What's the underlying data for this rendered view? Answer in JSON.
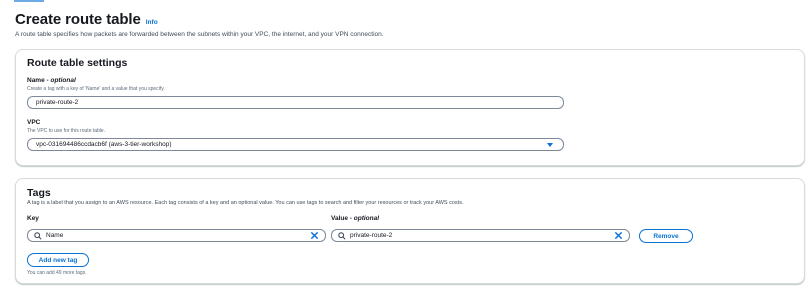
{
  "page": {
    "title": "Create route table",
    "info_label": "Info",
    "description": "A route table specifies how packets are forwarded between the subnets within your VPC, the internet, and your VPN connection."
  },
  "route_table_settings": {
    "title": "Route table settings",
    "name_label": "Name",
    "name_optional": " - optional",
    "name_desc": "Create a tag with a key of 'Name' and a value that you specify.",
    "name_value": "private-route-2",
    "vpc_label": "VPC",
    "vpc_desc": "The VPC to use for this route table.",
    "vpc_value": "vpc-031694486ccdacb6f (aws-3-tier-workshop)"
  },
  "tags": {
    "title": "Tags",
    "description": "A tag is a label that you assign to an AWS resource. Each tag consists of a key and an optional value. You can use tags to search and filter your resources or track your AWS costs.",
    "key_label": "Key",
    "value_label": "Value",
    "value_optional": " - optional",
    "key_value": "Name",
    "value_value": "private-route-2",
    "remove_label": "Remove",
    "add_label": "Add new tag",
    "limit_text": "You can add 49 more tags."
  },
  "icons": {
    "search": "search-icon",
    "clear": "close-icon",
    "dropdown": "caret-down-icon"
  },
  "colors": {
    "accent": "#0972d3",
    "text": "#16191f",
    "border": "#7d8998"
  }
}
